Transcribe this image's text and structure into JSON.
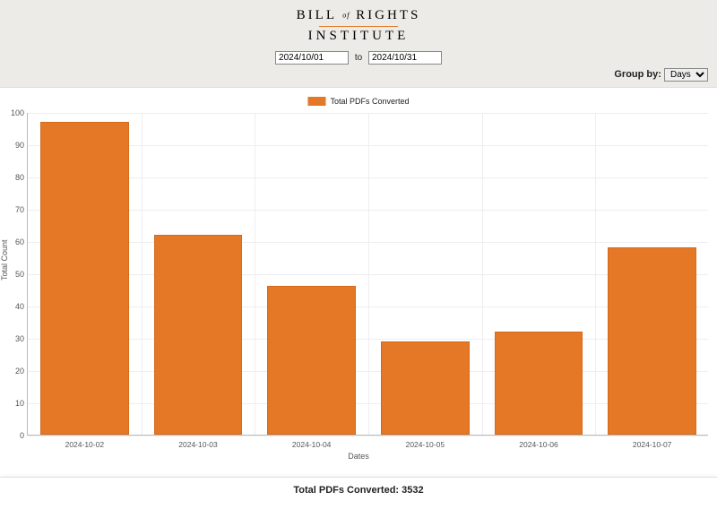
{
  "logo": {
    "top_left": "BILL",
    "top_of": "of",
    "top_right": "RIGHTS",
    "bottom": "INSTITUTE"
  },
  "date_range": {
    "from": "2024/10/01",
    "to_label": "to",
    "to": "2024/10/31"
  },
  "groupby": {
    "label": "Group by:",
    "selected": "Days"
  },
  "legend": {
    "series_label": "Total PDFs Converted"
  },
  "axes": {
    "ylabel": "Total Count",
    "xlabel": "Dates"
  },
  "footer": {
    "total_label": "Total PDFs Converted:",
    "total_value": "3532"
  },
  "chart_data": {
    "type": "bar",
    "title": "",
    "xlabel": "Dates",
    "ylabel": "Total Count",
    "ylim": [
      0,
      100
    ],
    "yticks": [
      0,
      10,
      20,
      30,
      40,
      50,
      60,
      70,
      80,
      90,
      100
    ],
    "categories": [
      "2024-10-02",
      "2024-10-03",
      "2024-10-04",
      "2024-10-05",
      "2024-10-06",
      "2024-10-07"
    ],
    "series": [
      {
        "name": "Total PDFs Converted",
        "values": [
          97,
          62,
          46,
          29,
          32,
          58
        ]
      }
    ]
  }
}
